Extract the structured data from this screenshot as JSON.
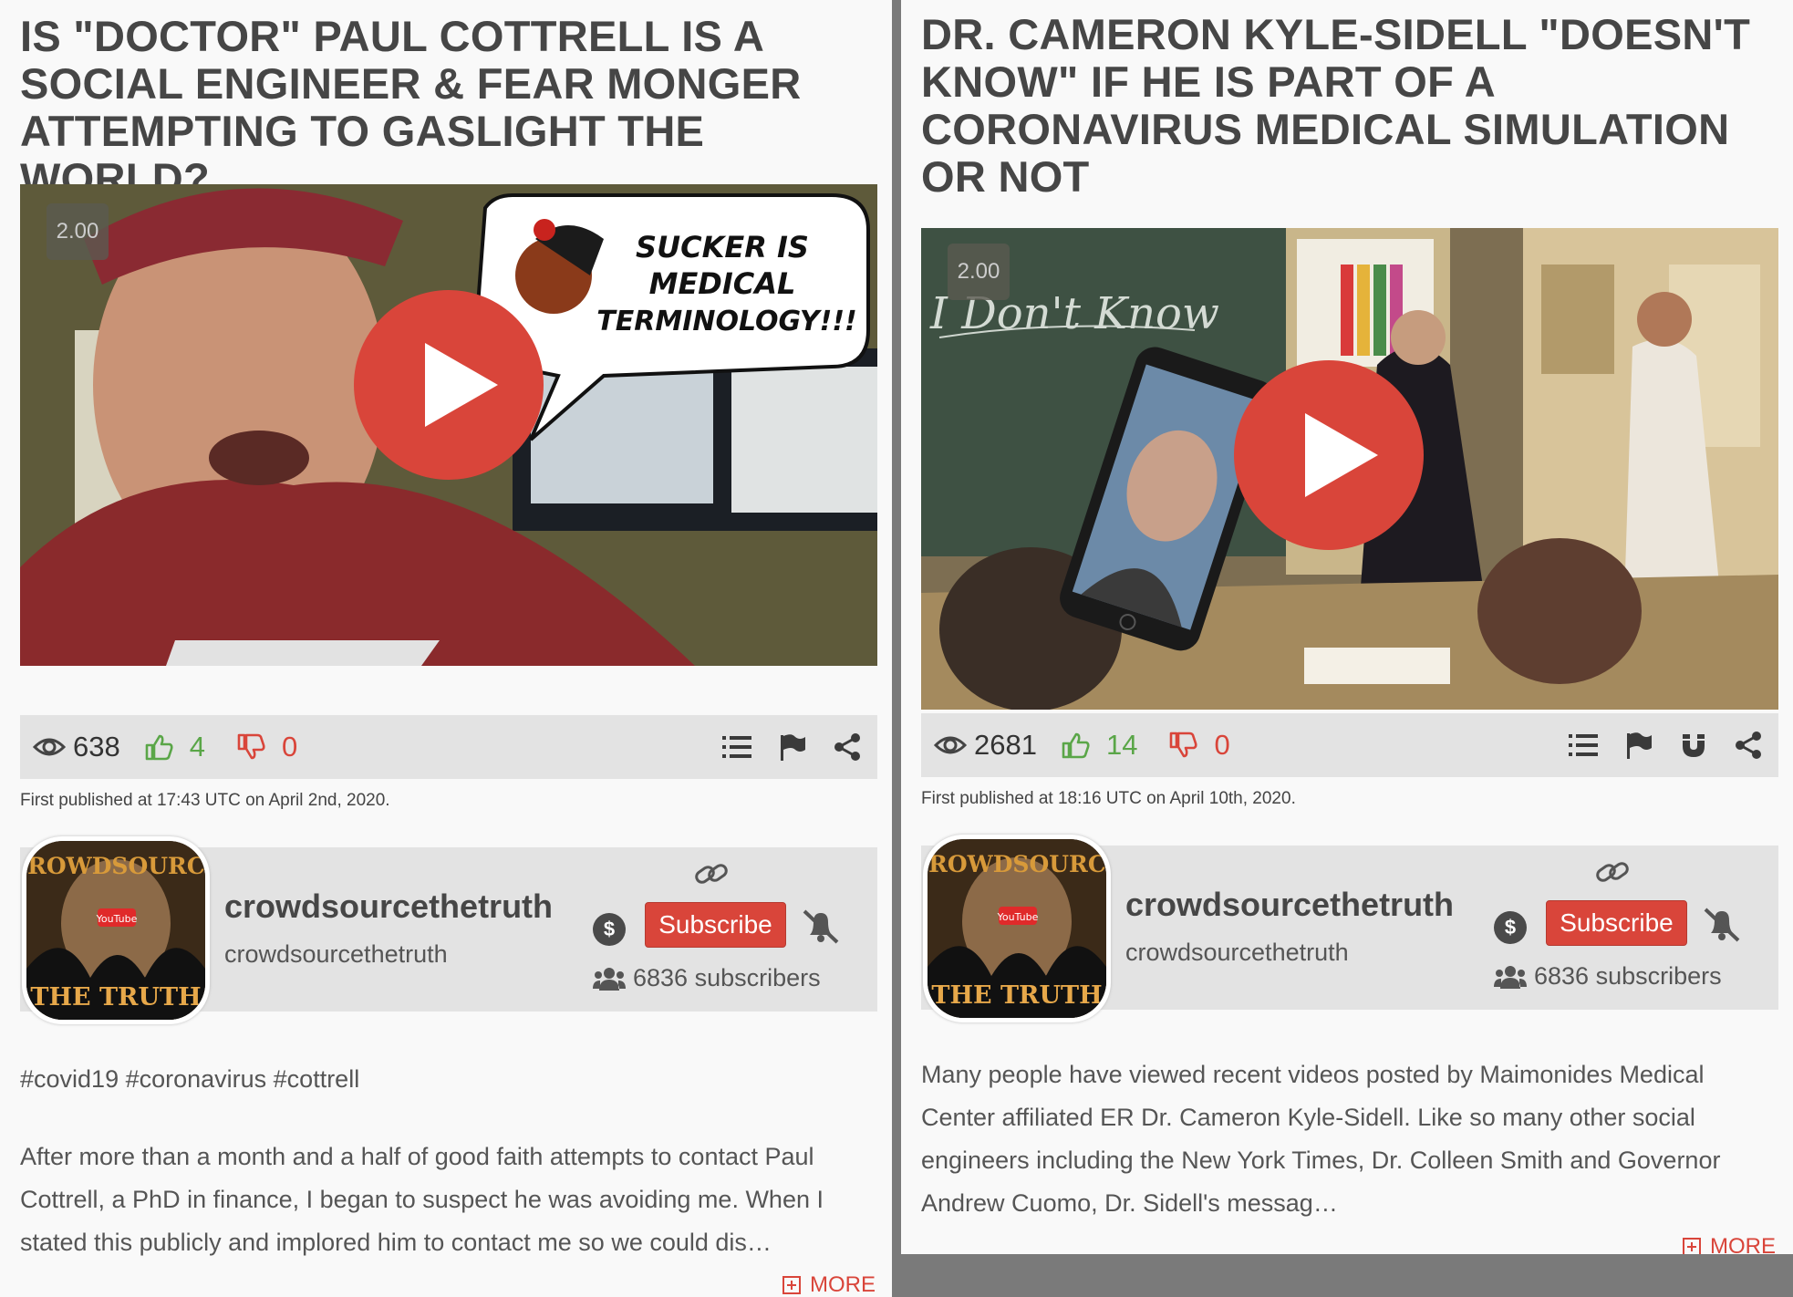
{
  "left": {
    "title": "IS \"DOCTOR\" PAUL COTTRELL IS A SOCIAL ENGINEER & FEAR MONGER ATTEMPTING TO GASLIGHT THE WORLD?",
    "speed": "2.00",
    "thumbnail_text": "SUCKER IS MEDICAL TERMINOLOGY!!!",
    "views": "638",
    "likes": "4",
    "dislikes": "0",
    "published": "First published at 17:43 UTC on April 2nd, 2020.",
    "channel_name": "crowdsourcethetruth",
    "channel_handle": "crowdsourcethetruth",
    "subscribe_label": "Subscribe",
    "subscribers": "6836 subscribers",
    "hashtags": "#covid19 #coronavirus #cottrell",
    "description": "After more than a month and a half of good faith attempts to contact Paul Cottrell, a PhD in finance, I began to suspect he was avoiding me. When I stated this publicly and implored him to contact me so we could dis…",
    "more_label": "MORE"
  },
  "right": {
    "title": "DR. CAMERON KYLE-SIDELL \"DOESN'T KNOW\" IF HE IS PART OF A CORONAVIRUS MEDICAL SIMULATION OR NOT",
    "speed": "2.00",
    "thumbnail_text": "I Don't Know",
    "views": "2681",
    "likes": "14",
    "dislikes": "0",
    "published": "First published at 18:16 UTC on April 10th, 2020.",
    "channel_name": "crowdsourcethetruth",
    "channel_handle": "crowdsourcethetruth",
    "subscribe_label": "Subscribe",
    "subscribers": "6836 subscribers",
    "description": "Many people have viewed recent videos posted by Maimonides Medical Center affiliated ER Dr. Cameron Kyle-Sidell. Like so many other social engineers including the New York Times, Dr. Colleen Smith and Governor Andrew Cuomo, Dr. Sidell's messag…",
    "more_label": "MORE"
  },
  "avatar_text": {
    "top": "CROWDSOURCE",
    "bottom": "THE TRUTH",
    "badge": "YouTube"
  },
  "colors": {
    "accent": "#d9453a",
    "like": "#5aa648",
    "bar": "#e3e3e3"
  }
}
